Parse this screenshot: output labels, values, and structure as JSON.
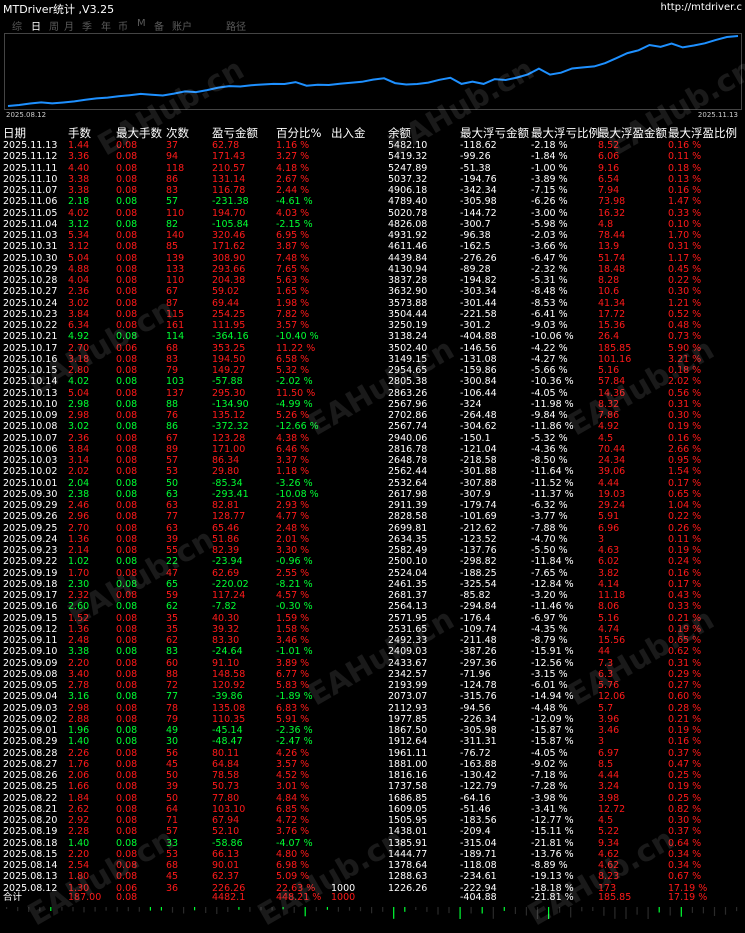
{
  "window": {
    "title": "MTDriver统计 ,V3.25",
    "url": "http://mtdriver.c"
  },
  "tabs": [
    {
      "label": "综",
      "active": false
    },
    {
      "label": "日",
      "active": true
    },
    {
      "label": "周",
      "active": false
    },
    {
      "label": "月",
      "active": false
    },
    {
      "label": "季",
      "active": false
    },
    {
      "label": "年",
      "active": false
    },
    {
      "label": "币",
      "active": false
    },
    {
      "label": "M",
      "active": false
    },
    {
      "label": "备",
      "active": false
    },
    {
      "label": "账户",
      "active": false
    },
    {
      "label": "路径",
      "active": false
    }
  ],
  "chart_data": {
    "type": "line",
    "x_start_label": "2025.08.12",
    "x_end_label": "2025.11.13",
    "line_color": "#1e90ff",
    "x": [
      "2025.08.12",
      "2025.08.13",
      "2025.08.14",
      "2025.08.15",
      "2025.08.18",
      "2025.08.19",
      "2025.08.20",
      "2025.08.21",
      "2025.08.22",
      "2025.08.25",
      "2025.08.26",
      "2025.08.27",
      "2025.08.28",
      "2025.08.29",
      "2025.09.01",
      "2025.09.02",
      "2025.09.03",
      "2025.09.04",
      "2025.09.05",
      "2025.09.08",
      "2025.09.09",
      "2025.09.10",
      "2025.09.11",
      "2025.09.12",
      "2025.09.15",
      "2025.09.16",
      "2025.09.17",
      "2025.09.18",
      "2025.09.19",
      "2025.09.22",
      "2025.09.23",
      "2025.09.24",
      "2025.09.25",
      "2025.09.26",
      "2025.09.29",
      "2025.09.30",
      "2025.10.01",
      "2025.10.02",
      "2025.10.03",
      "2025.10.06",
      "2025.10.07",
      "2025.10.08",
      "2025.10.09",
      "2025.10.10",
      "2025.10.13",
      "2025.10.14",
      "2025.10.15",
      "2025.10.16",
      "2025.10.17",
      "2025.10.21",
      "2025.10.22",
      "2025.10.23",
      "2025.10.24",
      "2025.10.27",
      "2025.10.28",
      "2025.10.29",
      "2025.10.30",
      "2025.10.31",
      "2025.11.03",
      "2025.11.04",
      "2025.11.05",
      "2025.11.06",
      "2025.11.07",
      "2025.11.10",
      "2025.11.11",
      "2025.11.12",
      "2025.11.13"
    ],
    "values": [
      1226.26,
      1288.63,
      1378.64,
      1444.77,
      1385.91,
      1438.01,
      1505.95,
      1609.05,
      1686.85,
      1737.58,
      1816.16,
      1881.0,
      1961.11,
      1912.64,
      1867.5,
      1977.85,
      2112.93,
      2073.07,
      2193.99,
      2342.57,
      2433.67,
      2409.03,
      2492.33,
      2531.65,
      2571.95,
      2564.13,
      2681.37,
      2461.35,
      2524.04,
      2500.1,
      2582.49,
      2634.35,
      2699.81,
      2828.58,
      2911.39,
      2617.98,
      2532.64,
      2562.44,
      2648.78,
      2816.78,
      2940.06,
      2567.74,
      2702.86,
      2567.96,
      2863.26,
      2805.38,
      2954.65,
      3149.15,
      3502.4,
      3138.24,
      3250.19,
      3504.44,
      3573.88,
      3632.9,
      3837.28,
      4130.94,
      4439.84,
      4611.46,
      4931.92,
      4826.08,
      5020.78,
      4789.4,
      4906.18,
      5037.32,
      5247.89,
      5419.32,
      5482.1
    ]
  },
  "table": {
    "headers": [
      "日期",
      "手数",
      "最大手数",
      "次数",
      "盈亏金额",
      "百分比%",
      "出入金",
      "余额",
      "最大浮亏金额",
      "最大浮亏比例",
      "最大浮盈金额",
      "最大浮盈比例"
    ],
    "rows": [
      [
        "2025.11.13",
        "1.44",
        "0.08",
        "37",
        "62.78",
        "1.16 %",
        "",
        "5482.10",
        "-118.62",
        "-2.18 %",
        "8.52",
        "0.16 %"
      ],
      [
        "2025.11.12",
        "3.36",
        "0.08",
        "94",
        "171.43",
        "3.27 %",
        "",
        "5419.32",
        "-99.26",
        "-1.84 %",
        "6.06",
        "0.11 %"
      ],
      [
        "2025.11.11",
        "4.40",
        "0.08",
        "118",
        "210.57",
        "4.18 %",
        "",
        "5247.89",
        "-51.38",
        "-1.00 %",
        "9.16",
        "0.18 %"
      ],
      [
        "2025.11.10",
        "3.38",
        "0.08",
        "86",
        "131.14",
        "2.67 %",
        "",
        "5037.32",
        "-194.76",
        "-3.89 %",
        "6.54",
        "0.13 %"
      ],
      [
        "2025.11.07",
        "3.38",
        "0.08",
        "83",
        "116.78",
        "2.44 %",
        "",
        "4906.18",
        "-342.34",
        "-7.15 %",
        "7.94",
        "0.16 %"
      ],
      [
        "2025.11.06",
        "2.18",
        "0.08",
        "57",
        "-231.38",
        "-4.61 %",
        "",
        "4789.40",
        "-305.98",
        "-6.26 %",
        "73.98",
        "1.47 %"
      ],
      [
        "2025.11.05",
        "4.02",
        "0.08",
        "110",
        "194.70",
        "4.03 %",
        "",
        "5020.78",
        "-144.72",
        "-3.00 %",
        "16.32",
        "0.33 %"
      ],
      [
        "2025.11.04",
        "3.12",
        "0.08",
        "82",
        "-105.84",
        "-2.15 %",
        "",
        "4826.08",
        "-300.7",
        "-5.98 %",
        "4.8",
        "0.10 %"
      ],
      [
        "2025.11.03",
        "5.34",
        "0.08",
        "140",
        "320.46",
        "6.95 %",
        "",
        "4931.92",
        "-96.38",
        "-2.03 %",
        "78.44",
        "1.70 %"
      ],
      [
        "2025.10.31",
        "3.12",
        "0.08",
        "85",
        "171.62",
        "3.87 %",
        "",
        "4611.46",
        "-162.5",
        "-3.66 %",
        "13.9",
        "0.31 %"
      ],
      [
        "2025.10.30",
        "5.04",
        "0.08",
        "139",
        "308.90",
        "7.48 %",
        "",
        "4439.84",
        "-276.26",
        "-6.47 %",
        "51.74",
        "1.17 %"
      ],
      [
        "2025.10.29",
        "4.88",
        "0.08",
        "133",
        "293.66",
        "7.65 %",
        "",
        "4130.94",
        "-89.28",
        "-2.32 %",
        "18.48",
        "0.45 %"
      ],
      [
        "2025.10.28",
        "4.04",
        "0.08",
        "110",
        "204.38",
        "5.63 %",
        "",
        "3837.28",
        "-194.82",
        "-5.31 %",
        "8.28",
        "0.22 %"
      ],
      [
        "2025.10.27",
        "2.36",
        "0.08",
        "67",
        "59.02",
        "1.65 %",
        "",
        "3632.90",
        "-303.34",
        "-8.48 %",
        "10.6",
        "0.30 %"
      ],
      [
        "2025.10.24",
        "3.02",
        "0.08",
        "87",
        "69.44",
        "1.98 %",
        "",
        "3573.88",
        "-301.44",
        "-8.53 %",
        "41.34",
        "1.21 %"
      ],
      [
        "2025.10.23",
        "3.84",
        "0.08",
        "115",
        "254.25",
        "7.82 %",
        "",
        "3504.44",
        "-221.58",
        "-6.41 %",
        "17.72",
        "0.52 %"
      ],
      [
        "2025.10.22",
        "6.34",
        "0.08",
        "161",
        "111.95",
        "3.57 %",
        "",
        "3250.19",
        "-301.2",
        "-9.03 %",
        "15.36",
        "0.48 %"
      ],
      [
        "2025.10.21",
        "4.92",
        "0.08",
        "114",
        "-364.16",
        "-10.40 %",
        "",
        "3138.24",
        "-404.88",
        "-10.06 %",
        "26.4",
        "0.73 %"
      ],
      [
        "2025.10.17",
        "2.70",
        "0.06",
        "68",
        "353.25",
        "11.22 %",
        "",
        "3502.40",
        "-146.56",
        "-4.22 %",
        "185.85",
        "5.90 %"
      ],
      [
        "2025.10.16",
        "3.18",
        "0.08",
        "83",
        "194.50",
        "6.58 %",
        "",
        "3149.15",
        "-131.08",
        "-4.27 %",
        "101.16",
        "3.21 %"
      ],
      [
        "2025.10.15",
        "2.80",
        "0.08",
        "79",
        "149.27",
        "5.32 %",
        "",
        "2954.65",
        "-159.86",
        "-5.66 %",
        "5.16",
        "0.18 %"
      ],
      [
        "2025.10.14",
        "4.02",
        "0.08",
        "103",
        "-57.88",
        "-2.02 %",
        "",
        "2805.38",
        "-300.84",
        "-10.36 %",
        "57.84",
        "2.02 %"
      ],
      [
        "2025.10.13",
        "5.04",
        "0.08",
        "137",
        "295.30",
        "11.50 %",
        "",
        "2863.26",
        "-106.44",
        "-4.05 %",
        "14.36",
        "0.56 %"
      ],
      [
        "2025.10.10",
        "2.98",
        "0.08",
        "88",
        "-134.90",
        "-4.99 %",
        "",
        "2567.96",
        "-324",
        "-11.98 %",
        "8.32",
        "0.31 %"
      ],
      [
        "2025.10.09",
        "2.98",
        "0.08",
        "76",
        "135.12",
        "5.26 %",
        "",
        "2702.86",
        "-264.48",
        "-9.84 %",
        "7.86",
        "0.30 %"
      ],
      [
        "2025.10.08",
        "3.02",
        "0.08",
        "86",
        "-372.32",
        "-12.66 %",
        "",
        "2567.74",
        "-304.62",
        "-11.86 %",
        "4.92",
        "0.19 %"
      ],
      [
        "2025.10.07",
        "2.36",
        "0.08",
        "67",
        "123.28",
        "4.38 %",
        "",
        "2940.06",
        "-150.1",
        "-5.32 %",
        "4.5",
        "0.16 %"
      ],
      [
        "2025.10.06",
        "3.84",
        "0.08",
        "89",
        "171.00",
        "6.46 %",
        "",
        "2816.78",
        "-121.04",
        "-4.36 %",
        "70.44",
        "2.66 %"
      ],
      [
        "2025.10.03",
        "3.14",
        "0.08",
        "57",
        "86.34",
        "3.37 %",
        "",
        "2648.78",
        "-218.58",
        "-8.50 %",
        "24.34",
        "0.95 %"
      ],
      [
        "2025.10.02",
        "2.02",
        "0.08",
        "53",
        "29.80",
        "1.18 %",
        "",
        "2562.44",
        "-301.88",
        "-11.64 %",
        "39.06",
        "1.54 %"
      ],
      [
        "2025.10.01",
        "2.04",
        "0.08",
        "50",
        "-85.34",
        "-3.26 %",
        "",
        "2532.64",
        "-307.88",
        "-11.52 %",
        "4.44",
        "0.17 %"
      ],
      [
        "2025.09.30",
        "2.38",
        "0.08",
        "63",
        "-293.41",
        "-10.08 %",
        "",
        "2617.98",
        "-307.9",
        "-11.37 %",
        "19.03",
        "0.65 %"
      ],
      [
        "2025.09.29",
        "2.46",
        "0.08",
        "63",
        "82.81",
        "2.93 %",
        "",
        "2911.39",
        "-179.74",
        "-6.32 %",
        "29.24",
        "1.04 %"
      ],
      [
        "2025.09.26",
        "2.96",
        "0.08",
        "77",
        "128.77",
        "4.77 %",
        "",
        "2828.58",
        "-101.69",
        "-3.77 %",
        "5.91",
        "0.22 %"
      ],
      [
        "2025.09.25",
        "2.70",
        "0.08",
        "63",
        "65.46",
        "2.48 %",
        "",
        "2699.81",
        "-212.62",
        "-7.88 %",
        "6.96",
        "0.26 %"
      ],
      [
        "2025.09.24",
        "1.36",
        "0.08",
        "39",
        "51.86",
        "2.01 %",
        "",
        "2634.35",
        "-123.52",
        "-4.70 %",
        "3",
        "0.11 %"
      ],
      [
        "2025.09.23",
        "2.14",
        "0.08",
        "55",
        "82.39",
        "3.30 %",
        "",
        "2582.49",
        "-137.76",
        "-5.50 %",
        "4.63",
        "0.19 %"
      ],
      [
        "2025.09.22",
        "1.02",
        "0.08",
        "22",
        "-23.94",
        "-0.96 %",
        "",
        "2500.10",
        "-298.82",
        "-11.84 %",
        "6.02",
        "0.24 %"
      ],
      [
        "2025.09.19",
        "1.70",
        "0.08",
        "47",
        "62.69",
        "2.55 %",
        "",
        "2524.04",
        "-188.25",
        "-7.65 %",
        "3.82",
        "0.16 %"
      ],
      [
        "2025.09.18",
        "2.30",
        "0.08",
        "65",
        "-220.02",
        "-8.21 %",
        "",
        "2461.35",
        "-325.54",
        "-12.84 %",
        "4.14",
        "0.17 %"
      ],
      [
        "2025.09.17",
        "2.32",
        "0.08",
        "59",
        "117.24",
        "4.57 %",
        "",
        "2681.37",
        "-85.82",
        "-3.20 %",
        "11.18",
        "0.43 %"
      ],
      [
        "2025.09.16",
        "2.60",
        "0.08",
        "62",
        "-7.82",
        "-0.30 %",
        "",
        "2564.13",
        "-294.84",
        "-11.46 %",
        "8.06",
        "0.33 %"
      ],
      [
        "2025.09.15",
        "1.52",
        "0.08",
        "35",
        "40.30",
        "1.59 %",
        "",
        "2571.95",
        "-176.4",
        "-6.97 %",
        "5.16",
        "0.21 %"
      ],
      [
        "2025.09.12",
        "1.36",
        "0.08",
        "35",
        "39.32",
        "1.58 %",
        "",
        "2531.65",
        "-109.74",
        "-4.35 %",
        "4.74",
        "0.19 %"
      ],
      [
        "2025.09.11",
        "2.48",
        "0.08",
        "62",
        "83.30",
        "3.46 %",
        "",
        "2492.33",
        "-211.48",
        "-8.79 %",
        "15.56",
        "0.65 %"
      ],
      [
        "2025.09.10",
        "3.38",
        "0.08",
        "83",
        "-24.64",
        "-1.01 %",
        "",
        "2409.03",
        "-387.26",
        "-15.91 %",
        "44",
        "0.62 %"
      ],
      [
        "2025.09.09",
        "2.20",
        "0.08",
        "60",
        "91.10",
        "3.89 %",
        "",
        "2433.67",
        "-297.36",
        "-12.56 %",
        "7.3",
        "0.31 %"
      ],
      [
        "2025.09.08",
        "3.40",
        "0.08",
        "88",
        "148.58",
        "6.77 %",
        "",
        "2342.57",
        "-71.96",
        "-3.15 %",
        "6.3",
        "0.29 %"
      ],
      [
        "2025.09.05",
        "2.78",
        "0.08",
        "72",
        "120.92",
        "5.83 %",
        "",
        "2193.99",
        "-124.78",
        "-6.01 %",
        "5.76",
        "0.27 %"
      ],
      [
        "2025.09.04",
        "3.16",
        "0.08",
        "77",
        "-39.86",
        "-1.89 %",
        "",
        "2073.07",
        "-315.76",
        "-14.94 %",
        "12.06",
        "0.60 %"
      ],
      [
        "2025.09.03",
        "2.98",
        "0.08",
        "78",
        "135.08",
        "6.83 %",
        "",
        "2112.93",
        "-94.56",
        "-4.48 %",
        "5.7",
        "0.28 %"
      ],
      [
        "2025.09.02",
        "2.88",
        "0.08",
        "79",
        "110.35",
        "5.91 %",
        "",
        "1977.85",
        "-226.34",
        "-12.09 %",
        "3.96",
        "0.21 %"
      ],
      [
        "2025.09.01",
        "1.96",
        "0.08",
        "49",
        "-45.14",
        "-2.36 %",
        "",
        "1867.50",
        "-305.98",
        "-15.87 %",
        "3.46",
        "0.19 %"
      ],
      [
        "2025.08.29",
        "1.40",
        "0.08",
        "30",
        "-48.47",
        "-2.47 %",
        "",
        "1912.64",
        "-311.31",
        "-15.87 %",
        "3",
        "0.16 %"
      ],
      [
        "2025.08.28",
        "2.26",
        "0.08",
        "56",
        "80.11",
        "4.26 %",
        "",
        "1961.11",
        "-76.72",
        "-4.05 %",
        "6.97",
        "0.37 %"
      ],
      [
        "2025.08.27",
        "1.76",
        "0.08",
        "45",
        "64.84",
        "3.57 %",
        "",
        "1881.00",
        "-163.88",
        "-9.02 %",
        "8.5",
        "0.47 %"
      ],
      [
        "2025.08.26",
        "2.06",
        "0.08",
        "50",
        "78.58",
        "4.52 %",
        "",
        "1816.16",
        "-130.42",
        "-7.18 %",
        "4.44",
        "0.25 %"
      ],
      [
        "2025.08.25",
        "1.66",
        "0.08",
        "39",
        "50.73",
        "3.01 %",
        "",
        "1737.58",
        "-122.79",
        "-7.28 %",
        "3.24",
        "0.19 %"
      ],
      [
        "2025.08.22",
        "1.84",
        "0.08",
        "50",
        "77.80",
        "4.84 %",
        "",
        "1686.85",
        "-64.16",
        "-3.98 %",
        "3.98",
        "0.25 %"
      ],
      [
        "2025.08.21",
        "2.62",
        "0.08",
        "64",
        "103.10",
        "6.85 %",
        "",
        "1609.05",
        "-51.46",
        "-3.41 %",
        "12.72",
        "0.82 %"
      ],
      [
        "2025.08.20",
        "2.92",
        "0.08",
        "71",
        "67.94",
        "4.72 %",
        "",
        "1505.95",
        "-183.56",
        "-12.77 %",
        "4.5",
        "0.30 %"
      ],
      [
        "2025.08.19",
        "2.28",
        "0.08",
        "57",
        "52.10",
        "3.76 %",
        "",
        "1438.01",
        "-209.4",
        "-15.11 %",
        "5.22",
        "0.37 %"
      ],
      [
        "2025.08.18",
        "1.40",
        "0.08",
        "33",
        "-58.86",
        "-4.07 %",
        "",
        "1385.91",
        "-315.04",
        "-21.81 %",
        "9.34",
        "0.64 %"
      ],
      [
        "2025.08.15",
        "2.20",
        "0.08",
        "53",
        "66.13",
        "4.80 %",
        "",
        "1444.77",
        "-189.71",
        "-13.76 %",
        "4.62",
        "0.34 %"
      ],
      [
        "2025.08.14",
        "2.54",
        "0.08",
        "68",
        "90.01",
        "6.98 %",
        "",
        "1378.64",
        "-118.08",
        "-8.89 %",
        "4.62",
        "0.34 %"
      ],
      [
        "2025.08.13",
        "1.80",
        "0.08",
        "45",
        "62.37",
        "5.09 %",
        "",
        "1288.63",
        "-234.61",
        "-19.13 %",
        "8.23",
        "0.67 %"
      ],
      [
        "2025.08.12",
        "1.30",
        "0.06",
        "36",
        "226.26",
        "22.63 %",
        "1000",
        "1226.26",
        "-222.94",
        "-18.18 %",
        "173",
        "17.19 %"
      ]
    ],
    "total": [
      "合计",
      "187.00",
      "0.08",
      "",
      "4482.1",
      "448.21 %",
      "1000",
      "",
      "-404.88",
      "-21.81 %",
      "185.85",
      "17.19 %"
    ]
  },
  "watermark": "EAHub.cn"
}
